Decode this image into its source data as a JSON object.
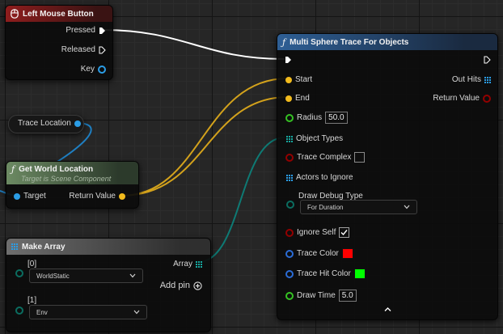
{
  "colors": {
    "exec": "#ffffff",
    "vector": "#f2bb1d",
    "object": "#2b9de6",
    "byte_enum": "#0b6d60",
    "trace_color": "#ff0000",
    "trace_hit_color": "#00ff00"
  },
  "left_mouse_button": {
    "title": "Left Mouse Button",
    "icon": "mouse-icon",
    "pressed": "Pressed",
    "released": "Released",
    "key": "Key"
  },
  "trace_location": {
    "label": "Trace Location"
  },
  "get_world_location": {
    "title": "Get World Location",
    "subtitle": "Target is Scene Component",
    "target": "Target",
    "return_value": "Return Value"
  },
  "make_array": {
    "title": "Make Array",
    "item0_index": "[0]",
    "item0_value": "WorldStatic",
    "item1_index": "[1]",
    "item1_value": "Env",
    "array": "Array",
    "add_pin": "Add pin"
  },
  "multi_sphere_trace": {
    "title": "Multi Sphere Trace For Objects",
    "start": "Start",
    "end": "End",
    "radius": "Radius",
    "radius_value": "50.0",
    "object_types": "Object Types",
    "trace_complex": "Trace Complex",
    "trace_complex_checked": false,
    "actors_to_ignore": "Actors to Ignore",
    "draw_debug_type": "Draw Debug Type",
    "draw_debug_value": "For Duration",
    "ignore_self": "Ignore Self",
    "ignore_self_checked": true,
    "trace_color": "Trace Color",
    "trace_hit_color": "Trace Hit Color",
    "draw_time": "Draw Time",
    "draw_time_value": "5.0",
    "out_hits": "Out Hits",
    "return_value": "Return Value"
  }
}
